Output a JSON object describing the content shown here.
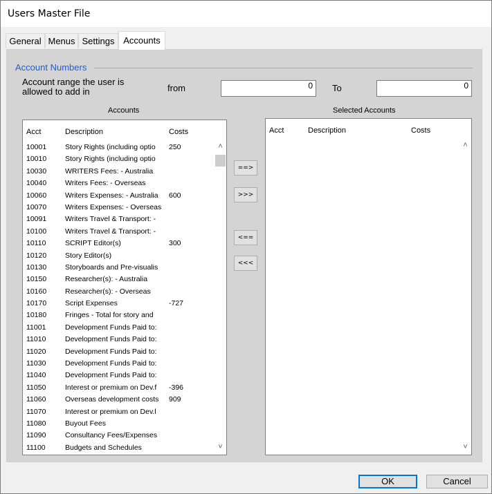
{
  "window": {
    "title": "Users Master File"
  },
  "tabs": [
    {
      "label": "General"
    },
    {
      "label": "Menus"
    },
    {
      "label": "Settings"
    },
    {
      "label": "Accounts",
      "active": true
    }
  ],
  "accounts_group": {
    "label": "Account Numbers",
    "range_label": "Account range the user is allowed to add in",
    "from_label": "from",
    "from_value": "0",
    "to_label": "To",
    "to_value": "0"
  },
  "accounts_list": {
    "caption": "Accounts",
    "columns": {
      "acct": "Acct",
      "description": "Description",
      "costs": "Costs"
    },
    "rows": [
      {
        "acct": "10001",
        "description": "Story Rights (including optio",
        "costs": "250"
      },
      {
        "acct": "10010",
        "description": "Story Rights (including optio",
        "costs": ""
      },
      {
        "acct": "10030",
        "description": "WRITERS Fees: - Australia",
        "costs": ""
      },
      {
        "acct": "10040",
        "description": "Writers Fees: - Overseas",
        "costs": ""
      },
      {
        "acct": "10060",
        "description": "Writers Expenses: - Australia",
        "costs": "600"
      },
      {
        "acct": "10070",
        "description": "Writers Expenses: - Overseas",
        "costs": ""
      },
      {
        "acct": "10091",
        "description": "Writers Travel & Transport: -",
        "costs": ""
      },
      {
        "acct": "10100",
        "description": "Writers Travel & Transport: -",
        "costs": ""
      },
      {
        "acct": "10110",
        "description": "SCRIPT Editor(s)",
        "costs": "300"
      },
      {
        "acct": "10120",
        "description": "Story Editor(s)",
        "costs": ""
      },
      {
        "acct": "10130",
        "description": "Storyboards and Pre-visualis",
        "costs": ""
      },
      {
        "acct": "10150",
        "description": "Researcher(s): - Australia",
        "costs": ""
      },
      {
        "acct": "10160",
        "description": "Researcher(s): - Overseas",
        "costs": ""
      },
      {
        "acct": "10170",
        "description": "Script Expenses",
        "costs": "-727"
      },
      {
        "acct": "10180",
        "description": "Fringes - Total for story and",
        "costs": ""
      },
      {
        "acct": "11001",
        "description": "Development Funds Paid to:",
        "costs": ""
      },
      {
        "acct": "11010",
        "description": "Development Funds Paid to:",
        "costs": ""
      },
      {
        "acct": "11020",
        "description": "Development Funds Paid to:",
        "costs": ""
      },
      {
        "acct": "11030",
        "description": "Development Funds Paid to:",
        "costs": ""
      },
      {
        "acct": "11040",
        "description": "Development Funds Paid to:",
        "costs": ""
      },
      {
        "acct": "11050",
        "description": "Interest or premium on Dev.f",
        "costs": "-396"
      },
      {
        "acct": "11060",
        "description": "Overseas development costs",
        "costs": "909"
      },
      {
        "acct": "11070",
        "description": "Interest or premium on Dev.l",
        "costs": ""
      },
      {
        "acct": "11080",
        "description": "Buyout Fees",
        "costs": ""
      },
      {
        "acct": "11090",
        "description": "Consultancy Fees/Expenses",
        "costs": ""
      },
      {
        "acct": "11100",
        "description": "Budgets and Schedules",
        "costs": ""
      }
    ]
  },
  "selected_list": {
    "caption": "Selected Accounts",
    "columns": {
      "acct": "Acct",
      "description": "Description",
      "costs": "Costs"
    },
    "rows": []
  },
  "transfer_buttons": {
    "add": "==>",
    "add_all": ">>>",
    "remove": "<==",
    "remove_all": "<<<"
  },
  "scroll_icons": {
    "up": "chevron-up-icon",
    "down": "chevron-down-icon"
  },
  "footer": {
    "ok": "OK",
    "cancel": "Cancel"
  },
  "colors": {
    "group_label": "#1f5fd6",
    "default_button_border": "#0078d7",
    "panel": "#d4d4d4"
  }
}
